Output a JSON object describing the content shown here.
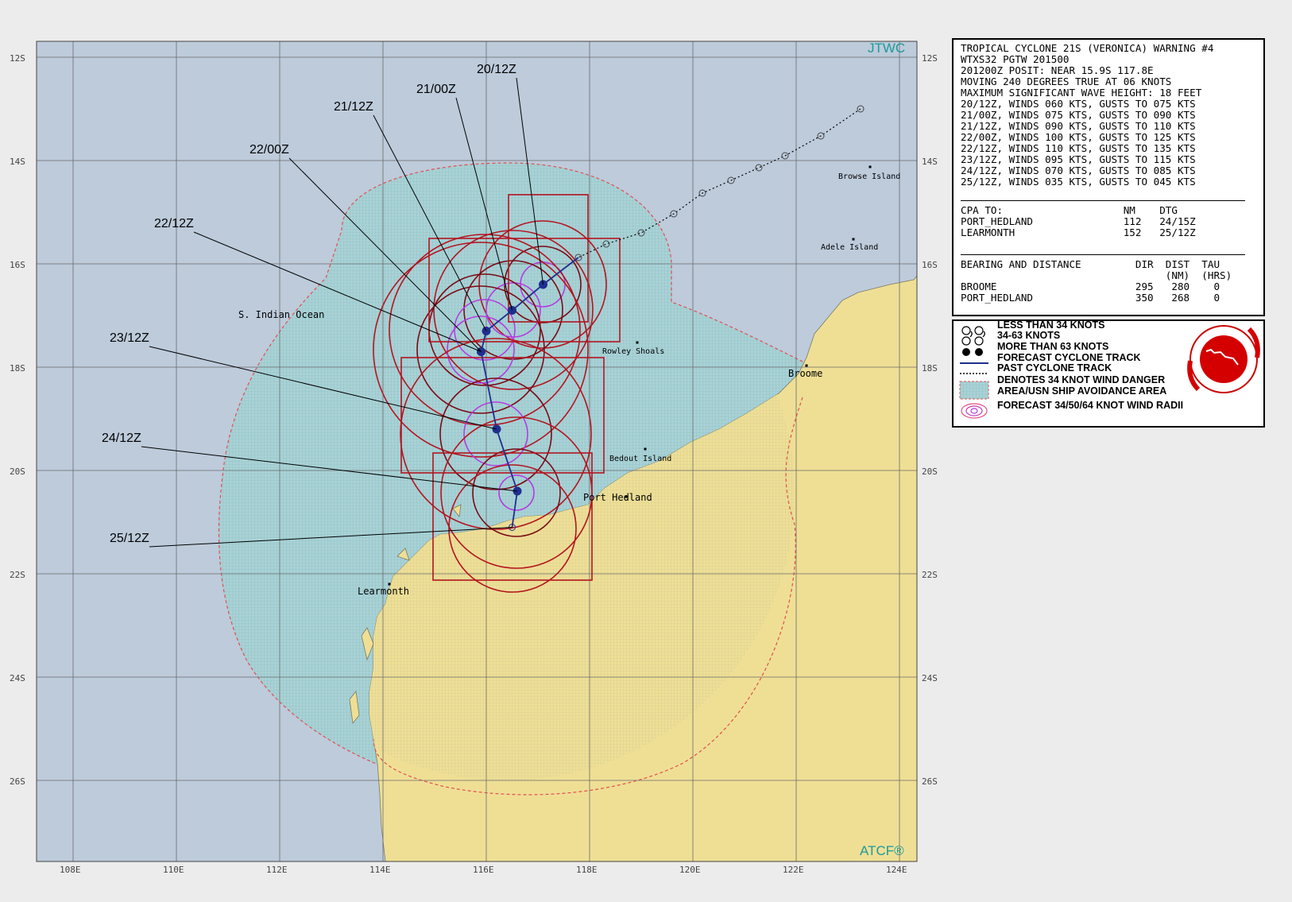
{
  "map": {
    "agency_label": "JTWC",
    "atcf_label": "ATCF®",
    "ocean_label": "S. Indian Ocean",
    "lat_labels": [
      "12S",
      "14S",
      "16S",
      "18S",
      "20S",
      "22S",
      "24S",
      "26S"
    ],
    "lon_labels": [
      "108E",
      "110E",
      "112E",
      "114E",
      "116E",
      "118E",
      "120E",
      "122E",
      "124E"
    ],
    "places": [
      {
        "name": "Browse Island"
      },
      {
        "name": "Adele Island"
      },
      {
        "name": "Rowley Shoals"
      },
      {
        "name": "Broome"
      },
      {
        "name": "Bedout Island"
      },
      {
        "name": "Port Hedland"
      },
      {
        "name": "Learmonth"
      }
    ],
    "forecast_points": [
      {
        "label": "20/12Z",
        "lat": -16.4,
        "lon": 117.1
      },
      {
        "label": "21/00Z",
        "lat": -16.9,
        "lon": 116.5
      },
      {
        "label": "21/12Z",
        "lat": -17.3,
        "lon": 116.0
      },
      {
        "label": "22/00Z",
        "lat": -17.7,
        "lon": 115.9
      },
      {
        "label": "22/12Z",
        "lat": -17.7,
        "lon": 115.9
      },
      {
        "label": "23/12Z",
        "lat": -19.2,
        "lon": 116.2
      },
      {
        "label": "24/12Z",
        "lat": -20.4,
        "lon": 116.6
      },
      {
        "label": "25/12Z",
        "lat": -21.1,
        "lon": 116.5
      }
    ],
    "colors": {
      "ocean": "#bdcbdb",
      "land": "#efdf95",
      "danger_area": "#9ed0d4",
      "radii_outer": "#b3141f",
      "radii_inner": "#7a0a14",
      "radii_64": "#b43ce0",
      "track": "#1f2f8f",
      "agency_text": "#1c9a9a"
    }
  },
  "warning": {
    "lines": [
      "TROPICAL CYCLONE 21S (VERONICA) WARNING #4",
      "WTXS32 PGTW 201500",
      "201200Z POSIT: NEAR 15.9S 117.8E",
      "MOVING 240 DEGREES TRUE AT 06 KNOTS",
      "MAXIMUM SIGNIFICANT WAVE HEIGHT: 18 FEET",
      "20/12Z, WINDS 060 KTS, GUSTS TO 075 KTS",
      "21/00Z, WINDS 075 KTS, GUSTS TO 090 KTS",
      "21/12Z, WINDS 090 KTS, GUSTS TO 110 KTS",
      "22/00Z, WINDS 100 KTS, GUSTS TO 125 KTS",
      "22/12Z, WINDS 110 KTS, GUSTS TO 135 KTS",
      "23/12Z, WINDS 095 KTS, GUSTS TO 115 KTS",
      "24/12Z, WINDS 070 KTS, GUSTS TO 085 KTS",
      "25/12Z, WINDS 035 KTS, GUSTS TO 045 KTS"
    ],
    "cpa_header": "CPA TO:                    NM    DTG",
    "cpa_rows": [
      "PORT_HEDLAND               112   24/15Z",
      "LEARMONTH                  152   25/12Z"
    ],
    "bearing_header": "BEARING AND DISTANCE         DIR  DIST  TAU",
    "bearing_sub": "                                  (NM)  (HRS)",
    "bearing_rows": [
      "BROOME                       295   280    0",
      "PORT_HEDLAND                 350   268    0"
    ]
  },
  "legend": {
    "items": [
      "LESS THAN 34 KNOTS",
      "34-63 KNOTS",
      "MORE THAN 63 KNOTS",
      "FORECAST CYCLONE TRACK",
      "PAST CYCLONE TRACK",
      "DENOTES 34 KNOT WIND DANGER",
      "AREA/USN SHIP AVOIDANCE AREA",
      "FORECAST 34/50/64 KNOT WIND RADII"
    ],
    "seal_lines": [
      "JOINT TYPHOON WARNING CENTER",
      "PEARL HARBOR",
      "HAWAII"
    ]
  }
}
